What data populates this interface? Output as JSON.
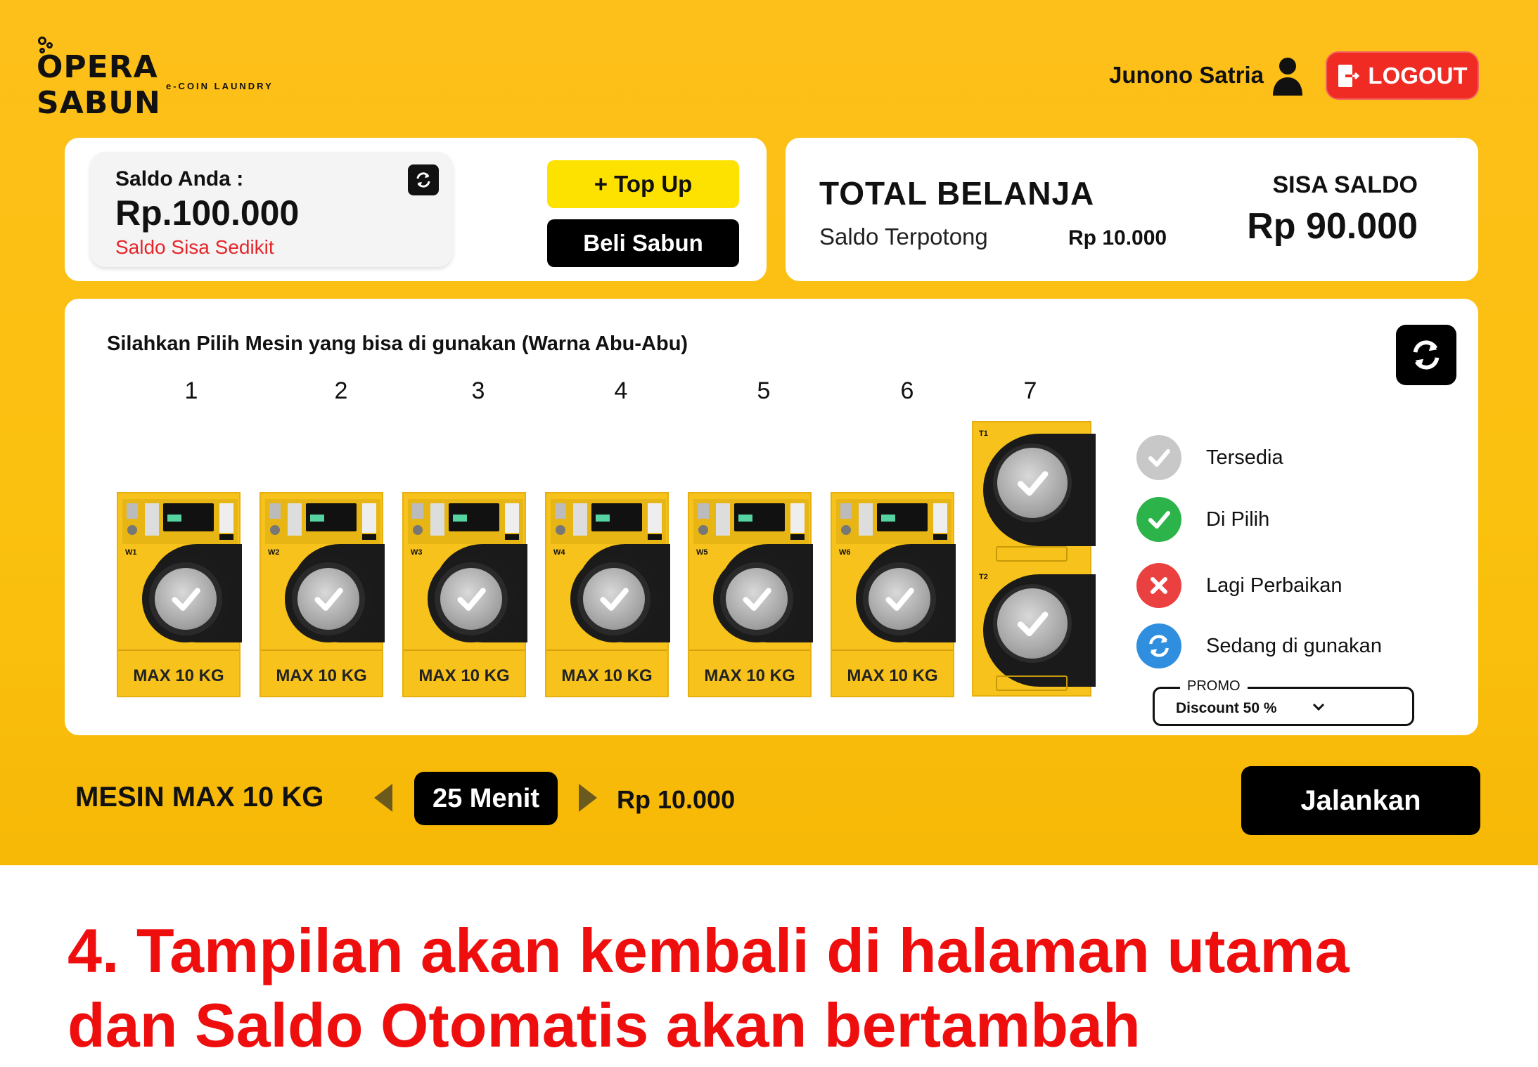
{
  "header": {
    "brand": "OPERA SABUN",
    "brand_tagline": "e-COIN LAUNDRY",
    "username": "Junono Satria",
    "logout_label": "LOGOUT"
  },
  "balance_card": {
    "label": "Saldo Anda :",
    "value": "Rp.100.000",
    "warning": "Saldo Sisa Sedikit",
    "topup_label": "+ Top Up",
    "buy_soap_label": "Beli Sabun"
  },
  "total_card": {
    "title": "TOTAL BELANJA",
    "deducted_label": "Saldo Terpotong",
    "deducted_amount": "Rp  10.000",
    "remaining_label": "SISA SALDO",
    "remaining_value": "Rp 90.000"
  },
  "machines": {
    "instruction": "Silahkan Pilih Mesin yang bisa di gunakan (Warna Abu-Abu)",
    "washers": [
      {
        "number": "1",
        "tag": "W1",
        "capacity": "MAX 10 KG",
        "status": "Tersedia"
      },
      {
        "number": "2",
        "tag": "W2",
        "capacity": "MAX 10 KG",
        "status": "Tersedia"
      },
      {
        "number": "3",
        "tag": "W3",
        "capacity": "MAX 10 KG",
        "status": "Tersedia"
      },
      {
        "number": "4",
        "tag": "W4",
        "capacity": "MAX 10 KG",
        "status": "Tersedia"
      },
      {
        "number": "5",
        "tag": "W5",
        "capacity": "MAX 10 KG",
        "status": "Tersedia"
      },
      {
        "number": "6",
        "tag": "W6",
        "capacity": "MAX 10 KG",
        "status": "Tersedia"
      }
    ],
    "dryer": {
      "number": "7",
      "top_tag": "T1",
      "bottom_tag": "T2",
      "status": "Tersedia"
    }
  },
  "legend": [
    {
      "label": "Tersedia",
      "color": "#c8c8c8",
      "icon": "check-icon"
    },
    {
      "label": "Di Pilih",
      "color": "#2cb34a",
      "icon": "check-icon"
    },
    {
      "label": "Lagi Perbaikan",
      "color": "#ea4040",
      "icon": "x-icon"
    },
    {
      "label": "Sedang di gunakan",
      "color": "#2f8fde",
      "icon": "sync-icon"
    }
  ],
  "promo": {
    "label": "PROMO",
    "value": "Discount 50 %"
  },
  "footer_bar": {
    "machine_label": "MESIN MAX 10 KG",
    "duration": "25 Menit",
    "price": "Rp 10.000",
    "run_label": "Jalankan"
  },
  "caption": {
    "line1": "4. Tampilan akan kembali di halaman utama",
    "line2": "dan Saldo Otomatis akan bertambah"
  },
  "colors": {
    "background": "#fcbd12",
    "logout": "#ef2b24",
    "topup": "#fde200",
    "caption": "#ee0e0e"
  }
}
